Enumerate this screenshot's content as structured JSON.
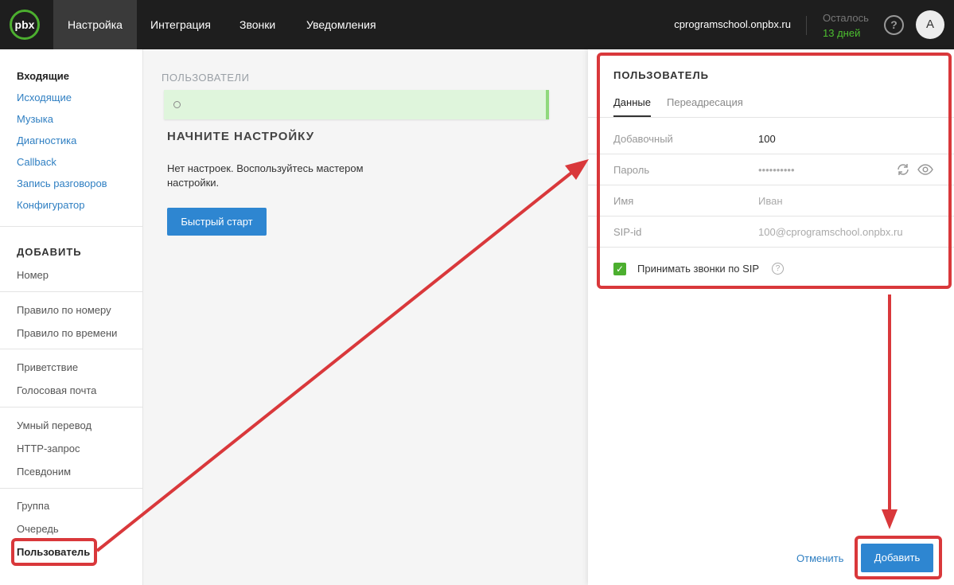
{
  "topbar": {
    "logo": "pbx",
    "nav": [
      "Настройка",
      "Интеграция",
      "Звонки",
      "Уведомления"
    ],
    "domain": "cprogramschool.onpbx.ru",
    "remain_label": "Осталось",
    "remain_days": "13 дней",
    "help": "?",
    "avatar": "А"
  },
  "sidebar": {
    "links": [
      "Входящие",
      "Исходящие",
      "Музыка",
      "Диагностика",
      "Callback",
      "Запись разговоров",
      "Конфигуратор"
    ],
    "add_header": "ДОБАВИТЬ",
    "groups": [
      [
        "Номер"
      ],
      [
        "Правило по номеру",
        "Правило по времени"
      ],
      [
        "Приветствие",
        "Голосовая почта"
      ],
      [
        "Умный перевод",
        "HTTP-запрос",
        "Псевдоним"
      ],
      [
        "Группа",
        "Очередь",
        "Пользователь"
      ]
    ]
  },
  "main": {
    "section_title": "ПОЛЬЗОВАТЕЛИ",
    "setup_title": "НАЧНИТЕ НАСТРОЙКУ",
    "setup_desc": "Нет настроек. Воспользуйтесь мастером настройки.",
    "quick_start": "Быстрый старт"
  },
  "panel": {
    "title": "ПОЛЬЗОВАТЕЛЬ",
    "tabs": [
      "Данные",
      "Переадресация"
    ],
    "fields": {
      "ext_label": "Добавочный",
      "ext_value": "100",
      "pass_label": "Пароль",
      "pass_value": "••••••••••",
      "name_label": "Имя",
      "name_placeholder": "Иван",
      "sip_label": "SIP-id",
      "sip_value": "100@cprogramschool.onpbx.ru"
    },
    "sip_checkbox_label": "Принимать звонки по SIP",
    "cancel": "Отменить",
    "add": "Добавить"
  },
  "colors": {
    "accent_blue": "#2e86d1",
    "brand_green": "#4caf2f",
    "annotation_red": "#d9383b"
  }
}
